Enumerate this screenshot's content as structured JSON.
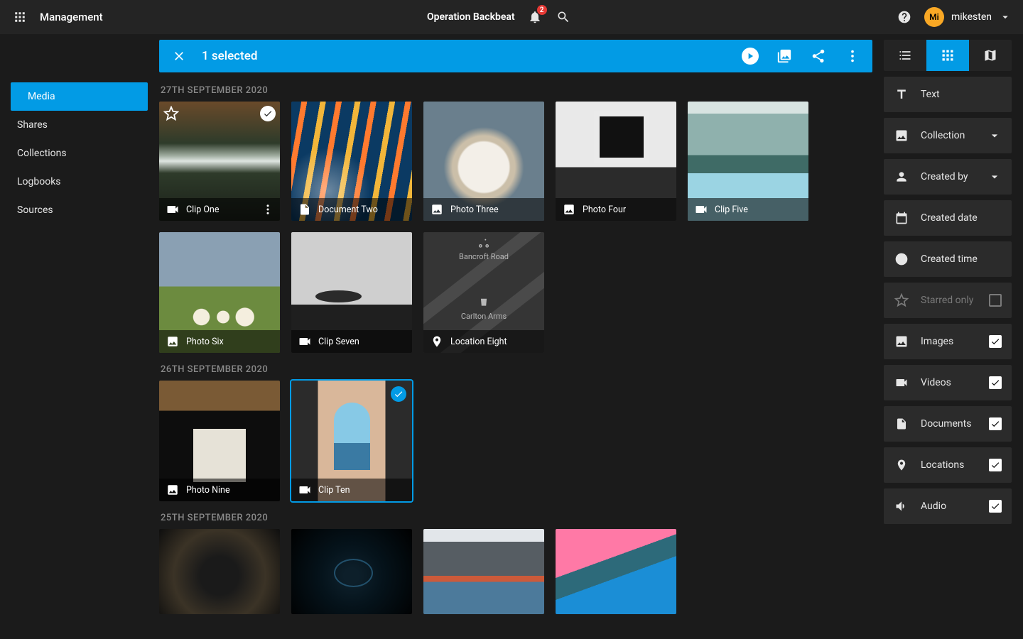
{
  "topbar": {
    "app_title": "Management",
    "operation_title": "Operation Backbeat",
    "notification_count": "2",
    "user_initials": "Mi",
    "user_name": "mikesten"
  },
  "sidebar": {
    "items": [
      {
        "label": "Media",
        "active": true
      },
      {
        "label": "Shares",
        "active": false
      },
      {
        "label": "Collections",
        "active": false
      },
      {
        "label": "Logbooks",
        "active": false
      },
      {
        "label": "Sources",
        "active": false
      }
    ]
  },
  "selection_bar": {
    "text": "1 selected"
  },
  "view_switch": {
    "active": "grid"
  },
  "filter_panel": {
    "text": {
      "label": "Text"
    },
    "collection": {
      "label": "Collection"
    },
    "created_by": {
      "label": "Created by"
    },
    "created_date": {
      "label": "Created date"
    },
    "created_time": {
      "label": "Created time"
    },
    "starred_only": {
      "label": "Starred only",
      "checked": false
    },
    "images": {
      "label": "Images",
      "checked": true
    },
    "videos": {
      "label": "Videos",
      "checked": true
    },
    "documents": {
      "label": "Documents",
      "checked": true
    },
    "locations": {
      "label": "Locations",
      "checked": true
    },
    "audio": {
      "label": "Audio",
      "checked": true
    }
  },
  "groups": [
    {
      "header": "27TH SEPTEMBER 2020",
      "tiles": [
        {
          "name": "Clip One",
          "type": "video",
          "starred": true,
          "picked": true
        },
        {
          "name": "Document Two",
          "type": "document"
        },
        {
          "name": "Photo Three",
          "type": "image"
        },
        {
          "name": "Photo Four",
          "type": "image"
        },
        {
          "name": "Clip Five",
          "type": "video"
        },
        {
          "name": "Photo Six",
          "type": "image"
        },
        {
          "name": "Clip Seven",
          "type": "video"
        },
        {
          "name": "Location Eight",
          "type": "location",
          "map_labels": {
            "a": "Bancroft Road",
            "b": "Carlton Arms"
          }
        }
      ]
    },
    {
      "header": "26TH SEPTEMBER 2020",
      "tiles": [
        {
          "name": "Photo Nine",
          "type": "image"
        },
        {
          "name": "Clip Ten",
          "type": "video",
          "selected": true
        }
      ]
    },
    {
      "header": "25TH SEPTEMBER 2020",
      "tiles": [
        {
          "name": "",
          "type": "image"
        },
        {
          "name": "",
          "type": "image"
        },
        {
          "name": "",
          "type": "image"
        },
        {
          "name": "",
          "type": "image"
        }
      ]
    }
  ]
}
